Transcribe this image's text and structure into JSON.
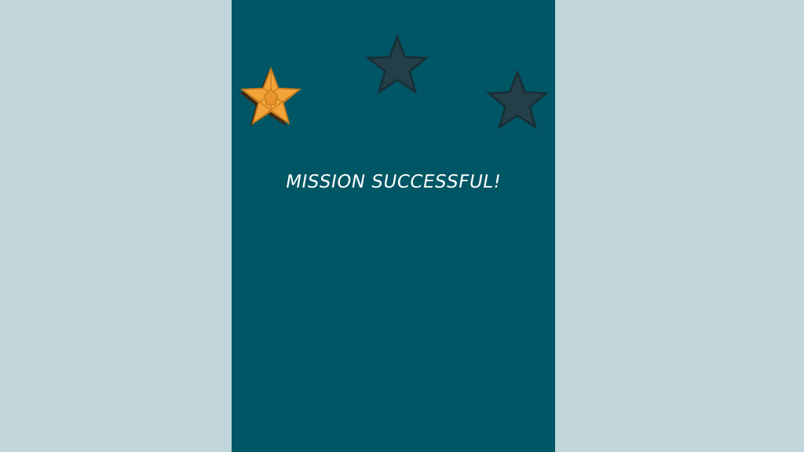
{
  "result": {
    "title": "MISSION SUCCESSFUL!",
    "stars_earned": 1,
    "stars_total": 3
  },
  "stars": [
    {
      "state": "earned",
      "icon": "gold-star-icon"
    },
    {
      "state": "empty",
      "icon": "empty-star-icon"
    },
    {
      "state": "empty",
      "icon": "empty-star-icon"
    }
  ],
  "colors": {
    "background": "#c0d6da",
    "panel": "#005664",
    "gold_star": "#f2a43a",
    "empty_star": "#243f47",
    "text": "#ffffff"
  }
}
